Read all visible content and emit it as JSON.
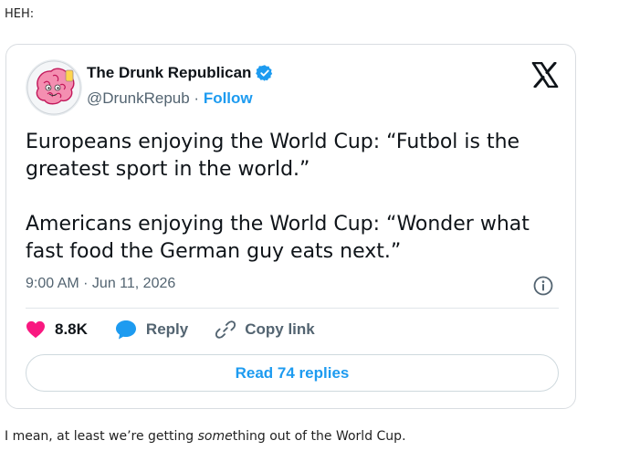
{
  "post": {
    "intro": "HEH:",
    "outro_pre": "I mean, at least we’re getting ",
    "outro_em": "some",
    "outro_post": "thing out of the World Cup."
  },
  "tweet": {
    "display_name": "The Drunk Republican",
    "handle": "@DrunkRepub",
    "separator": " · ",
    "follow_label": "Follow",
    "text": "Europeans enjoying the World Cup: “Futbol is the greatest sport in the world.”\n\nAmericans enjoying the World Cup: “Wonder what fast food the German guy eats next.”",
    "timestamp": "9:00 AM · Jun 11, 2026",
    "likes": "8.8K",
    "reply_label": "Reply",
    "copy_link_label": "Copy link",
    "read_replies_label": "Read 74 replies"
  },
  "icons": {
    "avatar": "pink-brain-avatar",
    "verified": "verified-badge-icon",
    "platform": "x-logo-icon",
    "info": "info-icon",
    "like": "heart-icon",
    "reply": "speech-bubble-icon",
    "copy_link": "link-icon"
  },
  "colors": {
    "accent": "#1d9bf0",
    "like": "#f91880",
    "text": "#0f1419",
    "muted": "#536471",
    "border": "#cfd9de"
  }
}
